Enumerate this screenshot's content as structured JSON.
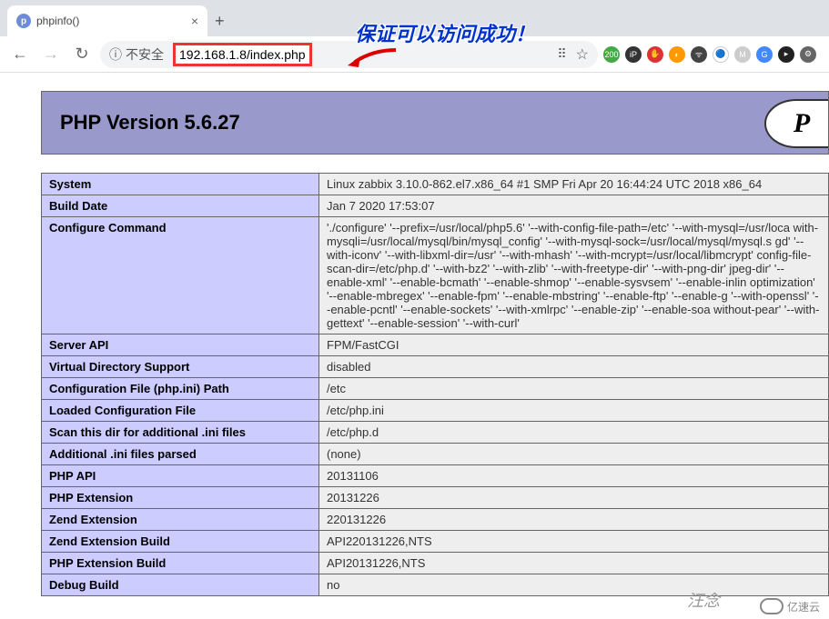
{
  "tab": {
    "title": "phpinfo()",
    "icon_letter": "p"
  },
  "url": {
    "insecure_label": "不安全",
    "address_highlighted": "192.168.1.8/index.php"
  },
  "annotation": {
    "text": "保证可以访问成功！"
  },
  "header": {
    "title": "PHP Version 5.6.27",
    "logo_text": "P"
  },
  "rows": [
    {
      "key": "System",
      "value": "Linux zabbix 3.10.0-862.el7.x86_64 #1 SMP Fri Apr 20 16:44:24 UTC 2018 x86_64"
    },
    {
      "key": "Build Date",
      "value": "Jan 7 2020 17:53:07"
    },
    {
      "key": "Configure Command",
      "value": "'./configure' '--prefix=/usr/local/php5.6' '--with-config-file-path=/etc' '--with-mysql=/usr/loca with-mysqli=/usr/local/mysql/bin/mysql_config' '--with-mysql-sock=/usr/local/mysql/mysql.s gd' '--with-iconv' '--with-libxml-dir=/usr' '--with-mhash' '--with-mcrypt=/usr/local/libmcrypt' config-file-scan-dir=/etc/php.d' '--with-bz2' '--with-zlib' '--with-freetype-dir' '--with-png-dir' jpeg-dir' '--enable-xml' '--enable-bcmath' '--enable-shmop' '--enable-sysvsem' '--enable-inlin optimization' '--enable-mbregex' '--enable-fpm' '--enable-mbstring' '--enable-ftp' '--enable-g '--with-openssl' '--enable-pcntl' '--enable-sockets' '--with-xmlrpc' '--enable-zip' '--enable-soa without-pear' '--with-gettext' '--enable-session' '--with-curl'"
    },
    {
      "key": "Server API",
      "value": "FPM/FastCGI"
    },
    {
      "key": "Virtual Directory Support",
      "value": "disabled"
    },
    {
      "key": "Configuration File (php.ini) Path",
      "value": "/etc"
    },
    {
      "key": "Loaded Configuration File",
      "value": "/etc/php.ini"
    },
    {
      "key": "Scan this dir for additional .ini files",
      "value": "/etc/php.d"
    },
    {
      "key": "Additional .ini files parsed",
      "value": "(none)"
    },
    {
      "key": "PHP API",
      "value": "20131106"
    },
    {
      "key": "PHP Extension",
      "value": "20131226"
    },
    {
      "key": "Zend Extension",
      "value": "220131226"
    },
    {
      "key": "Zend Extension Build",
      "value": "API220131226,NTS"
    },
    {
      "key": "PHP Extension Build",
      "value": "API20131226,NTS"
    },
    {
      "key": "Debug Build",
      "value": "no"
    }
  ],
  "ext_badge": "200",
  "watermark": "汪念",
  "corner_logo": "亿速云"
}
